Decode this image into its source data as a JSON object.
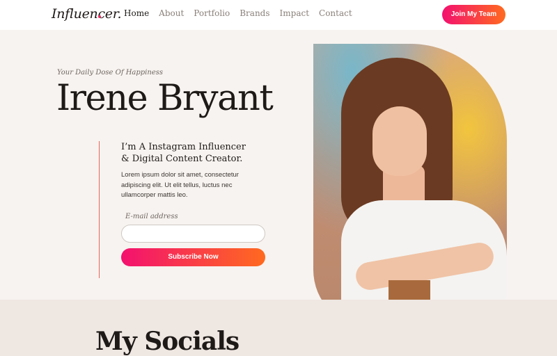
{
  "header": {
    "logo": "Influencer.",
    "nav": [
      {
        "label": "Home",
        "active": true
      },
      {
        "label": "About",
        "active": false
      },
      {
        "label": "Portfolio",
        "active": false
      },
      {
        "label": "Brands",
        "active": false
      },
      {
        "label": "Impact",
        "active": false
      },
      {
        "label": "Contact",
        "active": false
      }
    ],
    "cta_label": "Join My Team"
  },
  "hero": {
    "tagline": "Your Daily Dose Of Happiness",
    "name": "Irene Bryant",
    "subtitle": "I’m A Instagram Influencer & Digital Content Creator.",
    "body": "Lorem ipsum dolor sit amet, consectetur adipiscing elit. Ut elit tellus, luctus nec ullamcorper mattis leo.",
    "email_label": "E-mail address",
    "email_value": "",
    "subscribe_label": "Subscribe Now"
  },
  "socials": {
    "title": "My Socials"
  },
  "colors": {
    "accent_start": "#f3116f",
    "accent_end": "#ff6a1f",
    "background": "#f7f3f0",
    "divider": "#e2665d"
  }
}
